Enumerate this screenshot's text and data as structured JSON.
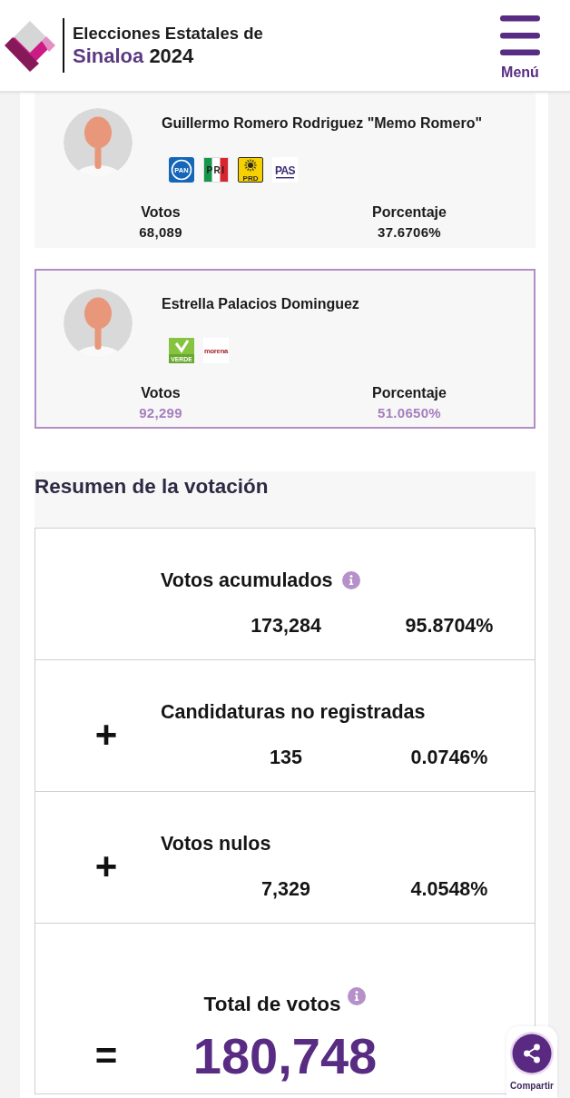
{
  "header": {
    "title": "Elecciones Estatales de",
    "state": "Sinaloa",
    "year": "2024",
    "menu_label": "Menú"
  },
  "candidates": [
    {
      "name": "Guillermo Romero Rodriguez \"Memo Romero\"",
      "leading": false,
      "parties": [
        {
          "kind": "pan",
          "text": "PAN"
        },
        {
          "kind": "pri",
          "text": "PRI"
        },
        {
          "kind": "prd",
          "text": "PRD"
        },
        {
          "kind": "pas",
          "text": "PAS"
        }
      ],
      "votes_label": "Votos",
      "votes": "68,089",
      "percent_label": "Porcentaje",
      "percent": "37.6706%"
    },
    {
      "name": "Estrella Palacios Dominguez",
      "leading": true,
      "parties": [
        {
          "kind": "verde",
          "text": "VERDE"
        },
        {
          "kind": "morena",
          "text": "morena"
        }
      ],
      "votes_label": "Votos",
      "votes": "92,299",
      "percent_label": "Porcentaje",
      "percent": "51.0650%"
    }
  ],
  "summary": {
    "title": "Resumen de la votación",
    "rows": [
      {
        "kind": "subtotal",
        "label": "Votos acumulados",
        "info": true,
        "votes": "173,284",
        "percent": "95.8704%"
      },
      {
        "kind": "addend",
        "sign": "+",
        "label": "Candidaturas no registradas",
        "info": false,
        "votes": "135",
        "percent": "0.0746%"
      },
      {
        "kind": "addend",
        "sign": "+",
        "label": "Votos nulos",
        "info": false,
        "votes": "7,329",
        "percent": "4.0548%"
      },
      {
        "kind": "total",
        "sign": "=",
        "label": "Total de votos",
        "info": true,
        "votes": "180,748"
      }
    ]
  },
  "share": {
    "label": "Compartir"
  }
}
